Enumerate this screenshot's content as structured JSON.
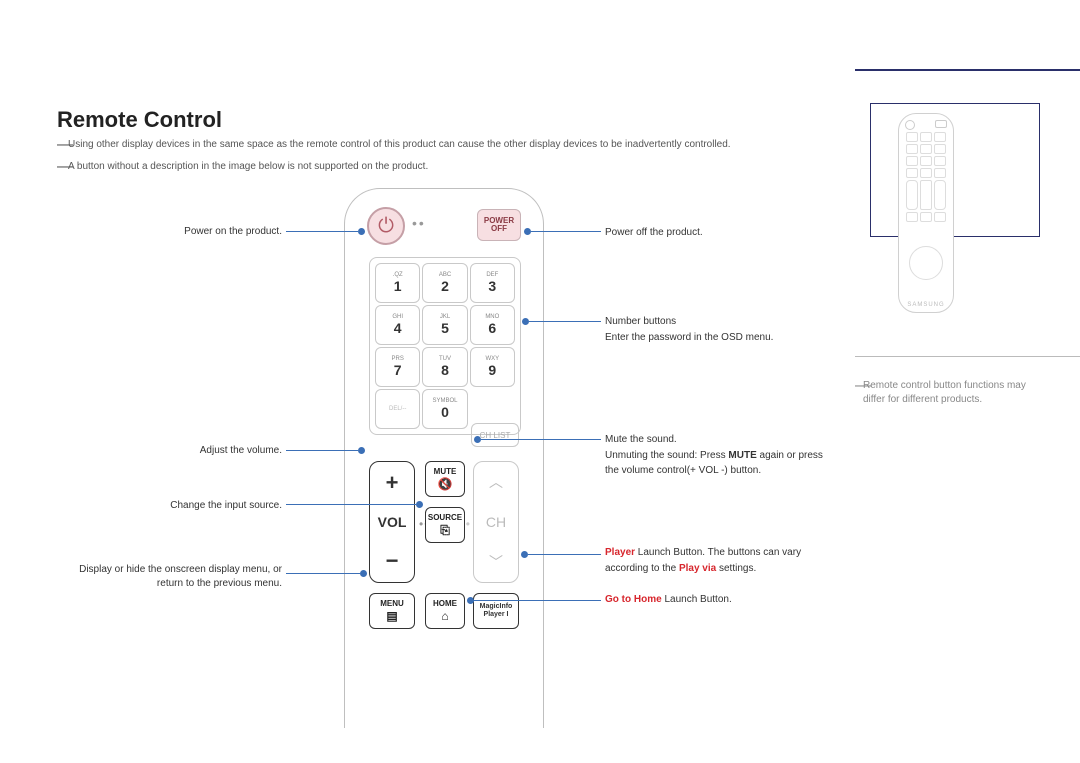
{
  "title": "Remote Control",
  "notes": {
    "n1": "Using other display devices in the same space as the remote control of this product can cause the other display devices to be inadvertently controlled.",
    "n2": "A button without a description in the image below is not supported on the product."
  },
  "dash": "―",
  "left": {
    "power_on": "Power on the product.",
    "volume": "Adjust the volume.",
    "source": "Change the input source.",
    "menu": "Display or hide the onscreen display menu, or return to the previous menu."
  },
  "right": {
    "power_off": "Power off the product.",
    "numbers_l1": "Number buttons",
    "numbers_l2": "Enter the password in the OSD menu.",
    "mute_l1": "Mute the sound.",
    "mute_l2_a": "Unmuting the sound: Press ",
    "mute_l2_b": "MUTE",
    "mute_l2_c": " again or press the volume control(+ VOL -) button.",
    "player_red": "Player",
    "player_rest": " Launch Button. The buttons can vary according to the ",
    "player_red2": "Play via",
    "player_rest2": " settings.",
    "home_red": "Go to Home",
    "home_rest": " Launch Button."
  },
  "buttons": {
    "power_off": {
      "l1": "POWER",
      "l2": "OFF"
    },
    "numpad": [
      {
        "sub": ".QZ",
        "n": "1"
      },
      {
        "sub": "ABC",
        "n": "2"
      },
      {
        "sub": "DEF",
        "n": "3"
      },
      {
        "sub": "GHI",
        "n": "4"
      },
      {
        "sub": "JKL",
        "n": "5"
      },
      {
        "sub": "MNO",
        "n": "6"
      },
      {
        "sub": "PRS",
        "n": "7"
      },
      {
        "sub": "TUV",
        "n": "8"
      },
      {
        "sub": "WXY",
        "n": "9"
      },
      {
        "sub": "DEL/--",
        "n": ""
      },
      {
        "sub": "SYMBOL",
        "n": "0"
      },
      {
        "sub": "",
        "n": ""
      }
    ],
    "chlist": "CH LIST",
    "vol": "VOL",
    "ch": "CH",
    "plus": "+",
    "minus": "−",
    "mute": "MUTE",
    "source": "SOURCE",
    "menu": "MENU",
    "home": "HOME",
    "magic_l1": "MagicInfo",
    "magic_l2": "Player I",
    "up_chev": "︿",
    "dn_chev": "﹀"
  },
  "sidebar": {
    "note": "Remote control button functions may differ for different products.",
    "brand": "SAMSUNG"
  }
}
